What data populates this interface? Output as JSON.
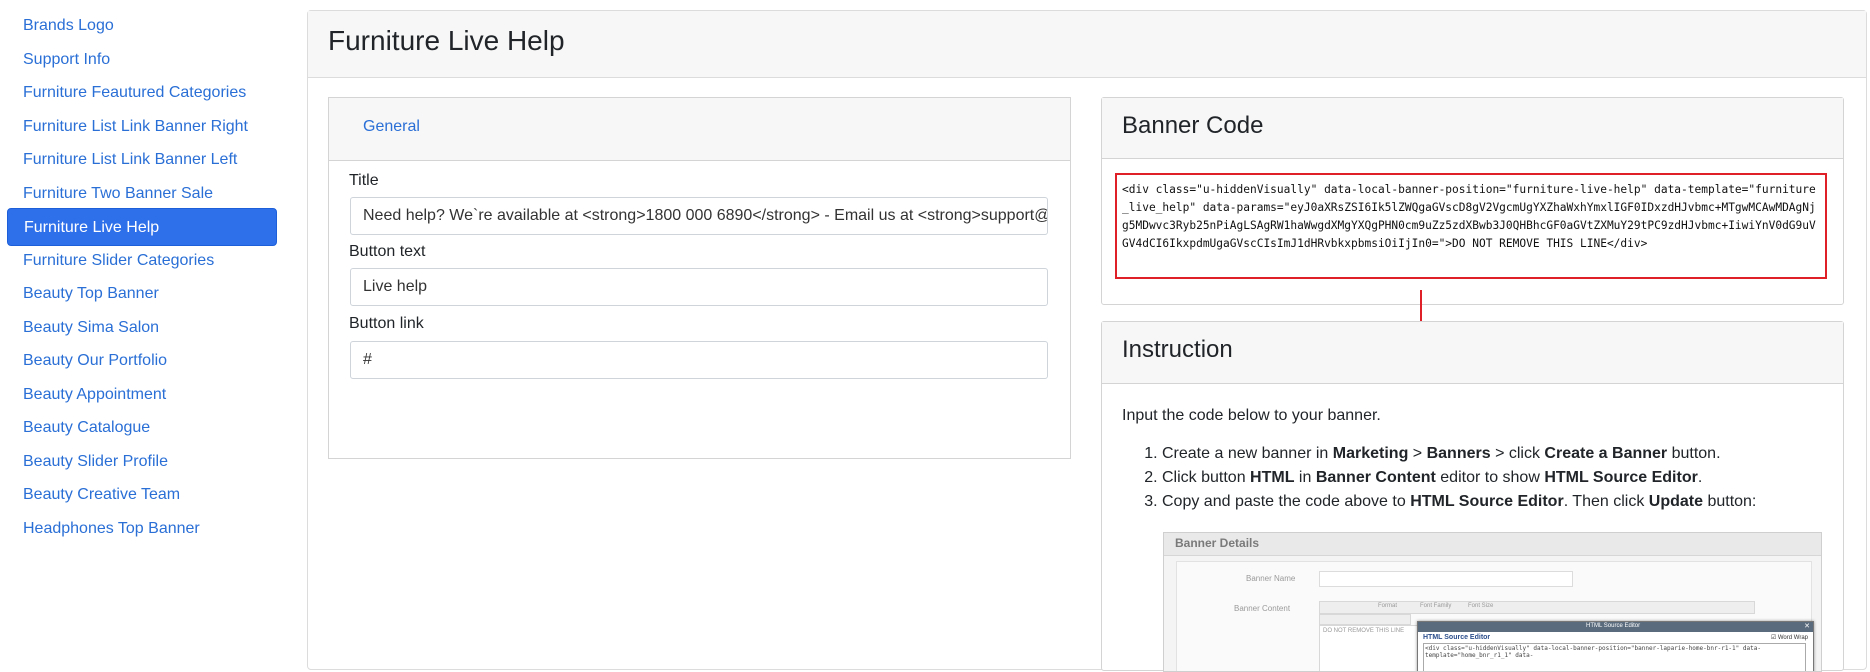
{
  "sidebar": {
    "items": [
      {
        "label": "Brands Logo",
        "active": false
      },
      {
        "label": "Support Info",
        "active": false
      },
      {
        "label": "Furniture Feautured Categories",
        "active": false
      },
      {
        "label": "Furniture List Link Banner Right",
        "active": false
      },
      {
        "label": "Furniture List Link Banner Left",
        "active": false
      },
      {
        "label": "Furniture Two Banner Sale",
        "active": false
      },
      {
        "label": "Furniture Live Help",
        "active": true
      },
      {
        "label": "Furniture Slider Categories",
        "active": false
      },
      {
        "label": "Beauty Top Banner",
        "active": false
      },
      {
        "label": "Beauty Sima Salon",
        "active": false
      },
      {
        "label": "Beauty Our Portfolio",
        "active": false
      },
      {
        "label": "Beauty Appointment",
        "active": false
      },
      {
        "label": "Beauty Catalogue",
        "active": false
      },
      {
        "label": "Beauty Slider Profile",
        "active": false
      },
      {
        "label": "Beauty Creative Team",
        "active": false
      },
      {
        "label": "Headphones Top Banner",
        "active": false
      }
    ]
  },
  "page": {
    "title": "Furniture Live Help"
  },
  "form": {
    "tab_general": "General",
    "title_label": "Title",
    "title_value": "Need help? We`re available at <strong>1800 000 6890</strong>  -  Email us at <strong>support@",
    "button_text_label": "Button text",
    "button_text_value": "Live help",
    "button_link_label": "Button link",
    "button_link_value": "#"
  },
  "banner_code": {
    "heading": "Banner Code",
    "code": "<div class=\"u-hiddenVisually\" data-local-banner-position=\"furniture-live-help\" data-template=\"furniture_live_help\" data-params=\"eyJ0aXRsZSI6Ik5lZWQgaGVscD8gV2VgcmUgYXZhaWxhYmxlIGF0IDxzdHJvbmc+MTgwMCAwMDAgNjg5MDwvc3Ryb25nPiAgLSAgRW1haWwgdXMgYXQgPHN0cm9uZz5zdXBwb3J0QHBhcGF0aGVtZXMuY29tPC9zdHJvbmc+IiwiYnV0dG9uVGV4dCI6IkxpdmUgaGVscCIsImJ1dHRvbkxpbmsiOiIjIn0=\">DO NOT REMOVE THIS LINE</div>",
    "highlight_color": "#e02028"
  },
  "instruction": {
    "heading": "Instruction",
    "intro": "Input the code below to your banner.",
    "step1": {
      "t1": "Create a new banner in ",
      "b1": "Marketing",
      "t2": " > ",
      "b2": "Banners",
      "t3": " > click ",
      "b3": "Create a Banner",
      "t4": " button."
    },
    "step2": {
      "t1": "Click button ",
      "b1": "HTML",
      "t2": " in ",
      "b2": "Banner Content",
      "t3": " editor to show ",
      "b3": "HTML Source Editor",
      "t4": "."
    },
    "step3": {
      "t1": "Copy and paste the code above to ",
      "b1": "HTML Source Editor",
      "t2": ". Then click ",
      "b2": "Update",
      "t3": " button:"
    }
  },
  "screenshot": {
    "title": "Banner Details",
    "banner_name_label": "Banner Name",
    "banner_content_label": "Banner Content",
    "toolbar_format": "Format",
    "toolbar_font_family": "Font Family",
    "toolbar_font_size": "Font Size",
    "editor_note": "DO NOT REMOVE THIS LINE",
    "dialog_bar_title": "HTML Source Editor",
    "dialog_heading": "HTML Source Editor",
    "word_wrap": "Word Wrap",
    "source_text": "<div class=\"u-hiddenVisually\" data-local-banner-position=\"banner-laparie-home-bnr-r1-1\" data-template=\"home_bnr_r1_1\" data-"
  },
  "colors": {
    "link": "#2a6fd6",
    "active_bg": "#2e6fea",
    "arrow": "#e02028"
  }
}
